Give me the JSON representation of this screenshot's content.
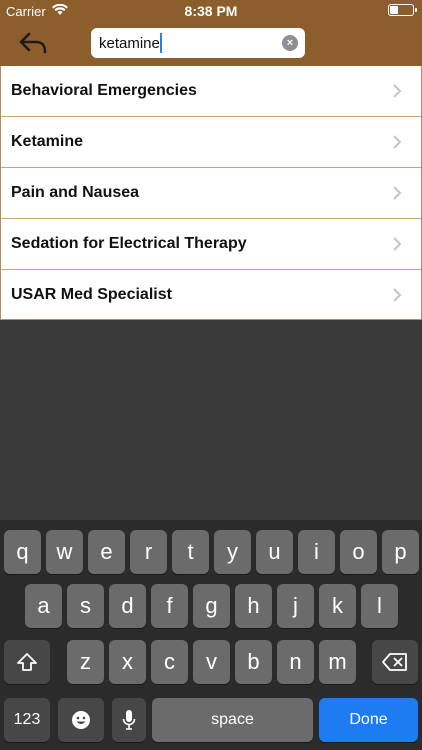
{
  "status": {
    "carrier": "Carrier",
    "time": "8:38 PM"
  },
  "search": {
    "value": "ketamine",
    "placeholder": ""
  },
  "results": [
    {
      "label": "Behavioral Emergencies"
    },
    {
      "label": "Ketamine"
    },
    {
      "label": "Pain and Nausea"
    },
    {
      "label": "Sedation for Electrical Therapy"
    },
    {
      "label": "USAR Med Specialist"
    }
  ],
  "keyboard": {
    "row1": [
      "q",
      "w",
      "e",
      "r",
      "t",
      "y",
      "u",
      "i",
      "o",
      "p"
    ],
    "row2": [
      "a",
      "s",
      "d",
      "f",
      "g",
      "h",
      "j",
      "k",
      "l"
    ],
    "row3": [
      "z",
      "x",
      "c",
      "v",
      "b",
      "n",
      "m"
    ],
    "numbers_label": "123",
    "space_label": "space",
    "done_label": "Done"
  },
  "colors": {
    "nav_brown": "#8b5e2c",
    "done_blue": "#1e7cf2",
    "row_border": "#c7a27a"
  },
  "icons": {
    "back": "reply-arrow-icon",
    "clear": "clear-circle-icon",
    "chevron": "chevron-right-icon"
  }
}
